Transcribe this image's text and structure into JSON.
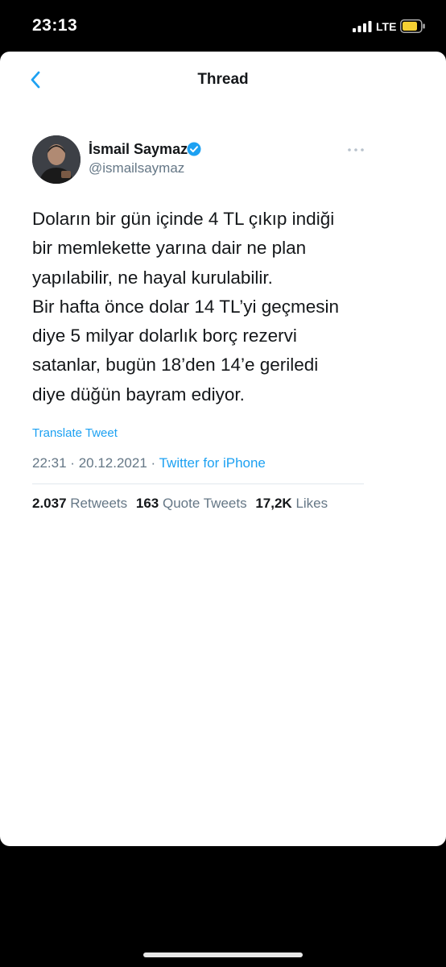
{
  "status_bar": {
    "time": "23:13",
    "network": "LTE",
    "battery_color": "#f5d033"
  },
  "nav": {
    "title": "Thread",
    "back_icon": "chevron-left-icon"
  },
  "author": {
    "name": "İsmail Saymaz",
    "handle": "@ismailsaymaz",
    "verified": true,
    "more_icon": "more-horizontal-icon"
  },
  "tweet": {
    "lines": [
      "Doların bir gün içinde 4 TL çıkıp indiği",
      "bir memlekette yarına dair ne plan",
      "yapılabilir, ne hayal kurulabilir.",
      "Bir hafta önce dolar 14 TL’yi geçmesin",
      "diye 5 milyar dolarlık borç rezervi",
      "satanlar, bugün 18’den 14’e geriledi",
      "diye düğün bayram ediyor."
    ],
    "translate_label": "Translate Tweet",
    "time": "22:31",
    "separator": "·",
    "date": "20.12.2021",
    "source": "Twitter for iPhone"
  },
  "stats": {
    "retweets": {
      "count": "2.037",
      "label": "Retweets"
    },
    "quotes": {
      "count": "163",
      "label": "Quote Tweets"
    },
    "likes": {
      "count": "17,2K",
      "label": "Likes"
    }
  },
  "colors": {
    "accent": "#1da1f2",
    "text": "#14171a",
    "secondary": "#657786"
  }
}
